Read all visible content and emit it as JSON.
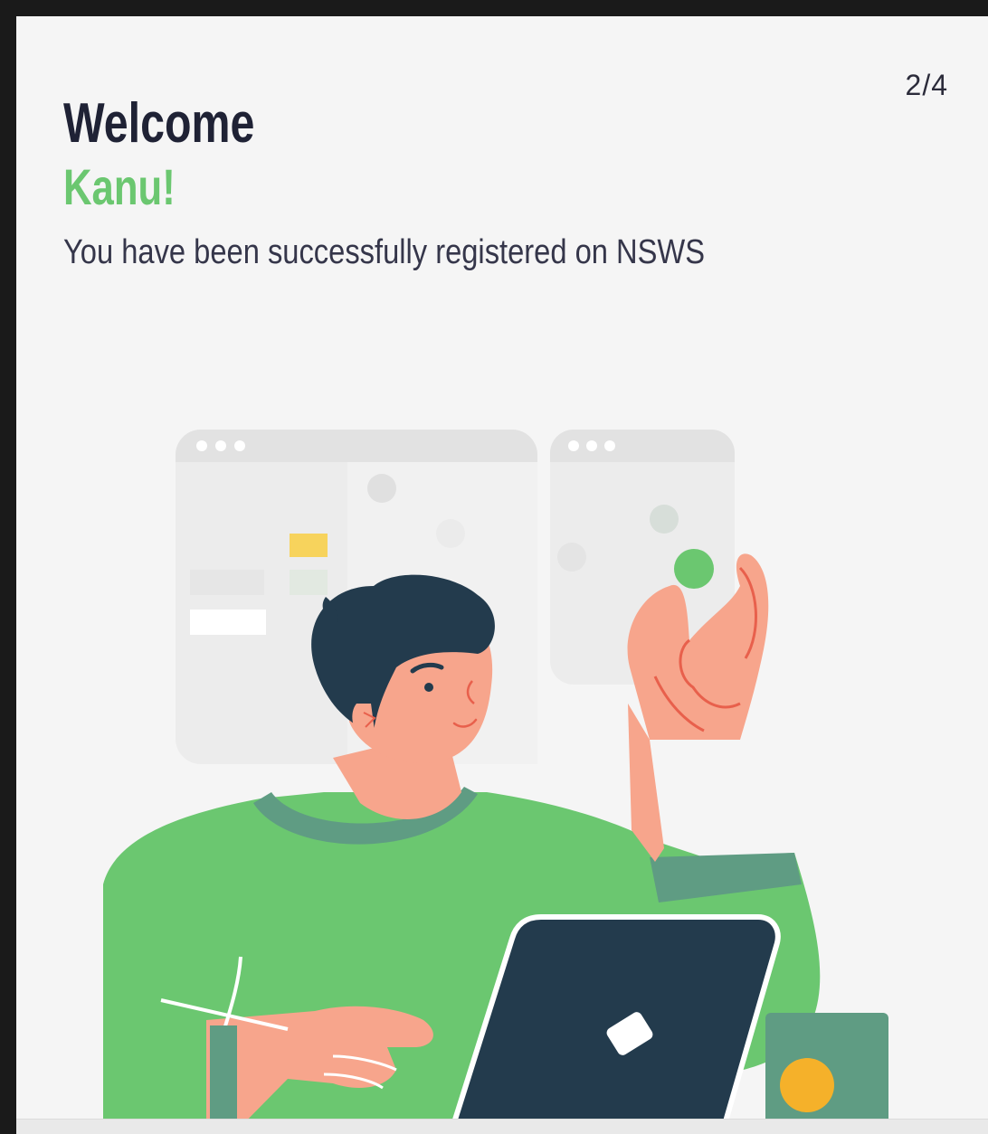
{
  "onboarding": {
    "step_counter": "2/4",
    "greeting": "Welcome",
    "user_name": "Kanu!",
    "message": "You have been successfully registered on NSWS"
  },
  "colors": {
    "accent": "#6bc770",
    "heading": "#1f2235",
    "shirt": "#6bc770",
    "collar": "#5f9c83",
    "skin": "#f7a58c",
    "hair": "#233b4d",
    "laptop": "#233b4d",
    "mug": "#5f9c83",
    "mug_dot": "#f5b12a"
  },
  "illustration": {
    "icon": "person-with-laptop-illustration"
  }
}
